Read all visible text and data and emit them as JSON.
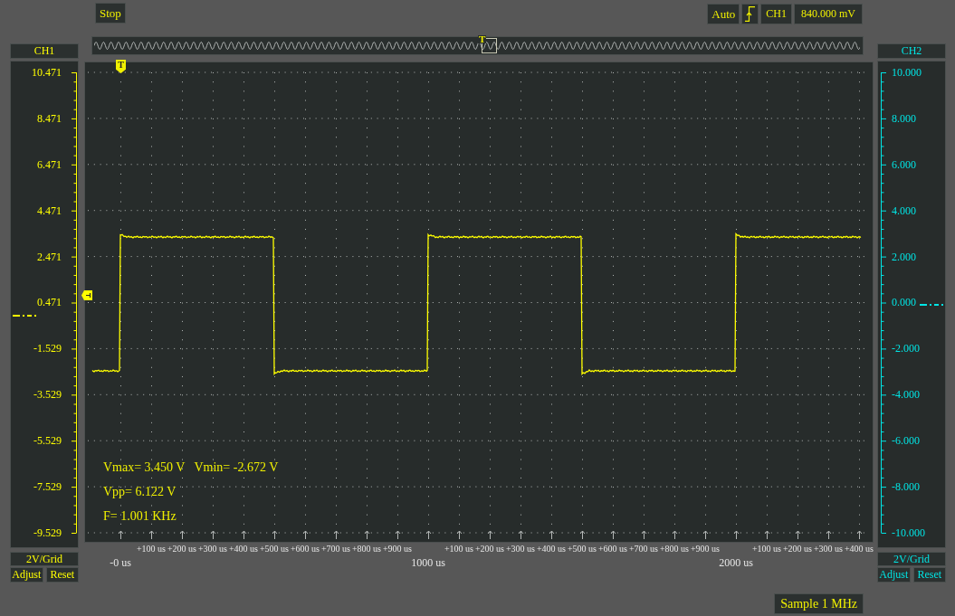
{
  "toolbar": {
    "run_button": "Stop",
    "trigger_mode": "Auto",
    "trigger_source": "CH1",
    "trigger_level": "840.000 mV"
  },
  "overview": {
    "trigger_marker": "T"
  },
  "channels": [
    {
      "name": "CH1",
      "color": "#ffff00",
      "labels": [
        "10.471",
        "8.471",
        "6.471",
        "4.471",
        "2.471",
        "0.471",
        "-1.529",
        "-3.529",
        "-5.529",
        "-7.529",
        "-9.529"
      ],
      "scale": "2V/Grid",
      "buttons": [
        "Adjust",
        "Reset"
      ]
    },
    {
      "name": "CH2",
      "color": "#00e5e5",
      "labels": [
        "10.000",
        "8.000",
        "6.000",
        "4.000",
        "2.000",
        "0.000",
        "-2.000",
        "-4.000",
        "-6.000",
        "-8.000",
        "-10.000"
      ],
      "scale": "2V/Grid",
      "buttons": [
        "Adjust",
        "Reset"
      ]
    }
  ],
  "plot": {
    "trigger_marker": "T",
    "measurements": [
      [
        "Vmax= 3.450 V",
        "Vmin= -2.672 V"
      ],
      [
        "Vpp= 6.122 V"
      ],
      [
        "F= 1.001 KHz"
      ]
    ]
  },
  "time_axis": {
    "offset_groups": [
      [
        "+100 us",
        "+200 us",
        "+300 us",
        "+400 us",
        "+500 us",
        "+600 us",
        "+700 us",
        "+800 us",
        "+900 us"
      ],
      [
        "+100 us",
        "+200 us",
        "+300 us",
        "+400 us",
        "+500 us",
        "+600 us",
        "+700 us",
        "+800 us",
        "+900 us"
      ],
      [
        "+100 us",
        "+200 us",
        "+300 us",
        "+400 us"
      ]
    ],
    "marks": [
      "-0 us",
      "1000 us",
      "2000 us"
    ]
  },
  "status": {
    "sample_rate": "Sample 1 MHz"
  }
}
